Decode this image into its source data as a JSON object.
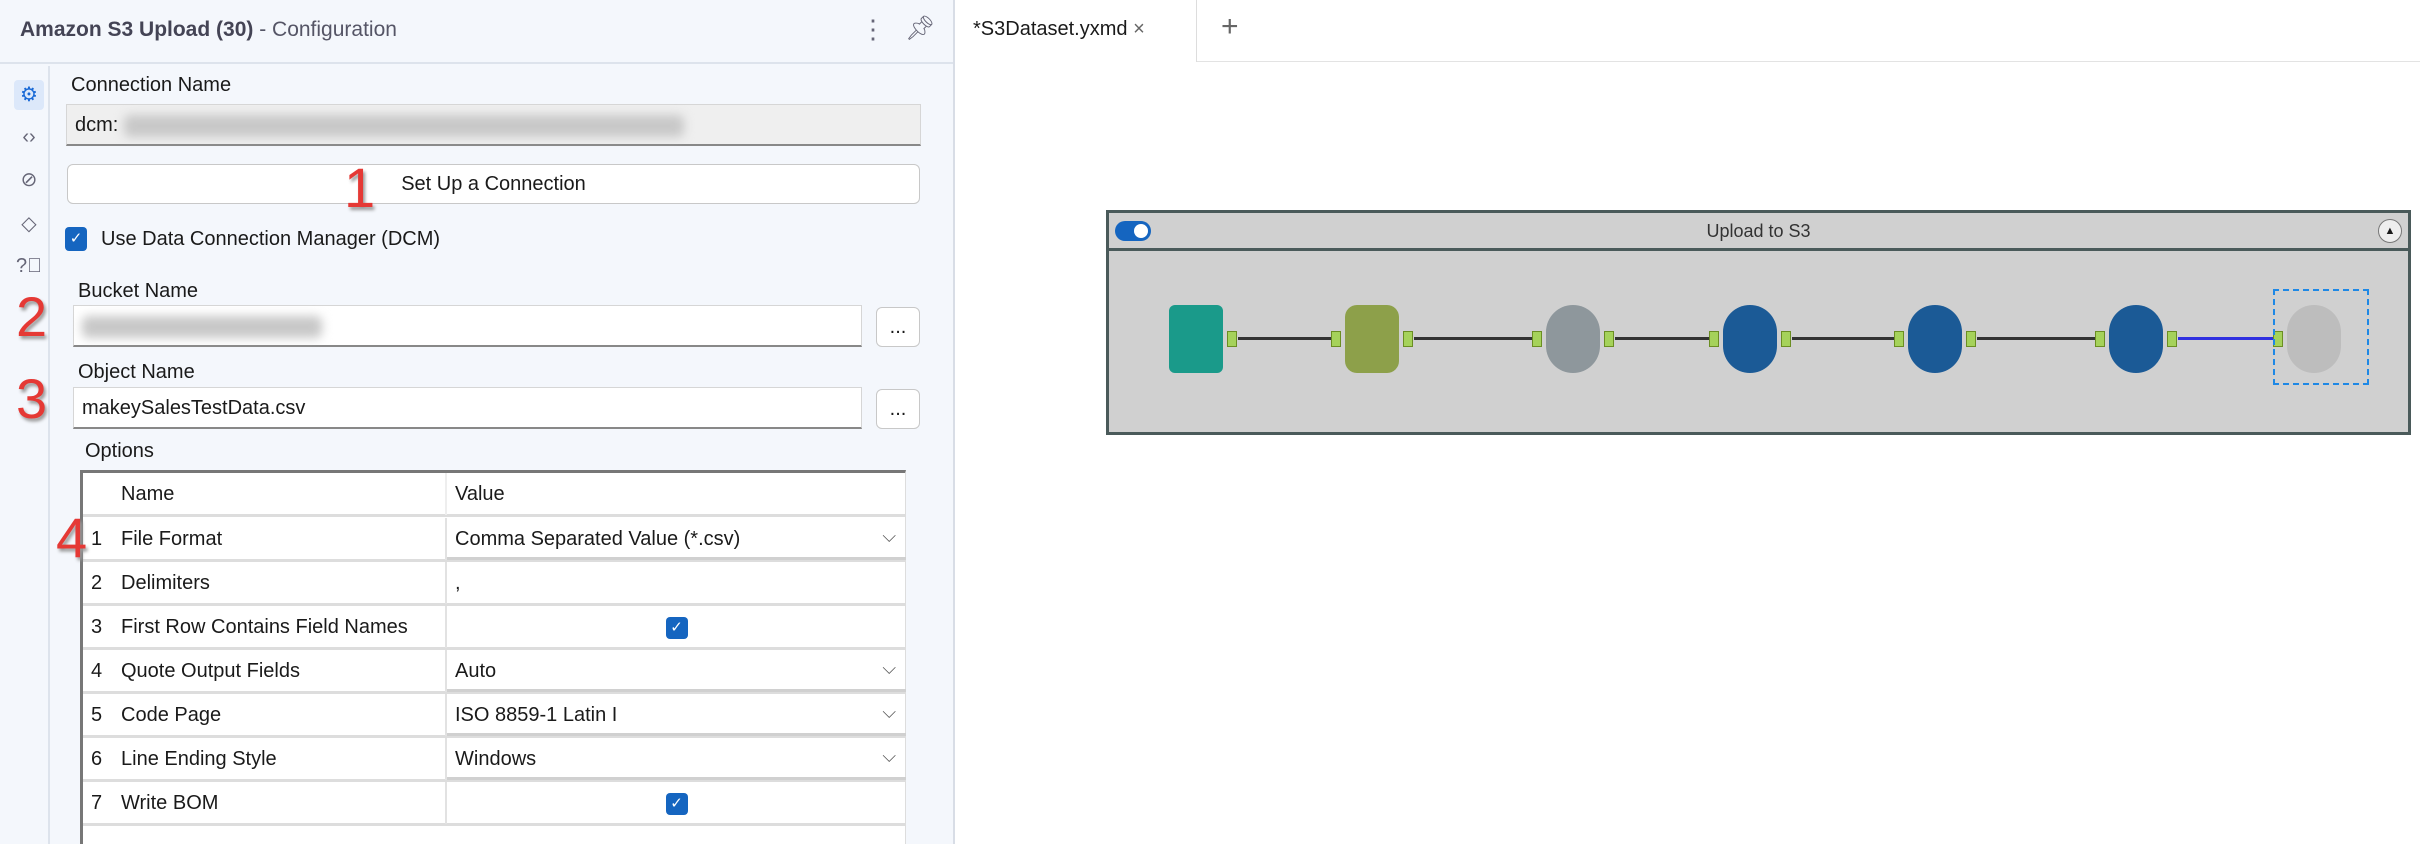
{
  "panel": {
    "title_bold": "Amazon S3 Upload (30)",
    "title_rest": " - Configuration"
  },
  "rail": [
    "gear-icon",
    "code-icon",
    "output-icon",
    "tag-icon",
    "help-icon"
  ],
  "form": {
    "connection_label": "Connection Name",
    "connection_prefix": "dcm:",
    "setup_button": "Set Up a Connection",
    "dcm_checkbox_label": "Use Data Connection Manager (DCM)",
    "dcm_checked": true,
    "bucket_label": "Bucket Name",
    "object_label": "Object Name",
    "object_value": "makeySalesTestData.csv",
    "browse_label": "...",
    "options_label": "Options"
  },
  "annotations": [
    "1",
    "2",
    "3",
    "4"
  ],
  "table": {
    "headers": [
      "Name",
      "Value"
    ],
    "rows": [
      {
        "n": "1",
        "name": "File Format",
        "value": "Comma Separated Value (*.csv)",
        "type": "dropdown"
      },
      {
        "n": "2",
        "name": "Delimiters",
        "value": ",",
        "type": "text"
      },
      {
        "n": "3",
        "name": "First Row Contains Field Names",
        "value": "",
        "type": "checkbox",
        "checked": true
      },
      {
        "n": "4",
        "name": "Quote Output Fields",
        "value": "Auto",
        "type": "dropdown"
      },
      {
        "n": "5",
        "name": "Code Page",
        "value": "ISO 8859-1 Latin I",
        "type": "dropdown"
      },
      {
        "n": "6",
        "name": "Line Ending Style",
        "value": "Windows",
        "type": "dropdown"
      },
      {
        "n": "7",
        "name": "Write BOM",
        "value": "",
        "type": "checkbox",
        "checked": true
      }
    ]
  },
  "tabs": {
    "active": "*S3Dataset.yxmd",
    "close": "×",
    "add": "+"
  },
  "canvas": {
    "container_title": "Upload to S3",
    "tools": [
      {
        "name": "input-data-tool",
        "color": "#1a9a8a"
      },
      {
        "name": "select-tool",
        "color": "#8da04a"
      },
      {
        "name": "formula-tool",
        "color": "#8e979c"
      },
      {
        "name": "data-cleansing-tool",
        "color": "#1b5a96"
      },
      {
        "name": "browse-tool",
        "color": "#1b5a96"
      },
      {
        "name": "test-tool",
        "color": "#1b5a96"
      },
      {
        "name": "s3-upload-tool",
        "color": "#bdbdbd"
      }
    ]
  }
}
